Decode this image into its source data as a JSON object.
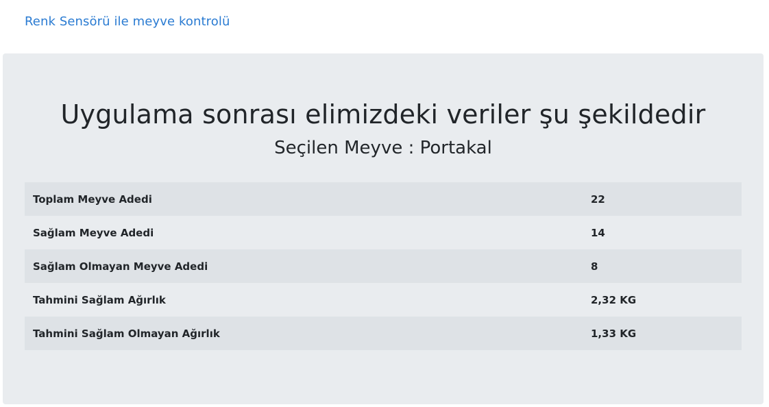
{
  "nav": {
    "brand_link": "Renk Sensörü ile meyve kontrolü"
  },
  "main": {
    "title": "Uygulama sonrası elimizdeki veriler şu şekildedir",
    "subtitle": "Seçilen Meyve : Portakal"
  },
  "table": {
    "rows": [
      {
        "label": "Toplam Meyve Adedi",
        "value": "22"
      },
      {
        "label": "Sağlam Meyve Adedi",
        "value": "14"
      },
      {
        "label": "Sağlam Olmayan Meyve Adedi",
        "value": "8"
      },
      {
        "label": "Tahmini Sağlam Ağırlık",
        "value": "2,32 KG"
      },
      {
        "label": "Tahmini Sağlam Olmayan Ağırlık",
        "value": "1,33 KG"
      }
    ]
  },
  "colors": {
    "link": "#2a7bd2",
    "panel_bg": "#e9ecef",
    "stripe": "#dee2e6"
  }
}
